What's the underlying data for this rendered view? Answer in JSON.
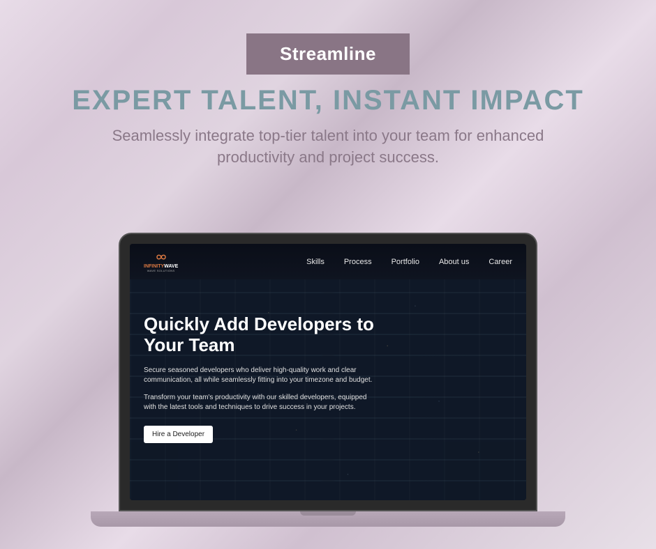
{
  "badge": "Streamline",
  "title": "EXPERT TALENT, INSTANT IMPACT",
  "subtitle": "Seamlessly integrate top-tier talent into your team for enhanced productivity and project success.",
  "site": {
    "logo": {
      "name1": "INFINITY",
      "name2": "WAVE",
      "sub": "WAVE SOLUTIONS"
    },
    "nav": [
      "Skills",
      "Process",
      "Portfolio",
      "About us",
      "Career"
    ],
    "hero": {
      "title": "Quickly Add Developers to Your Team",
      "p1": "Secure seasoned developers who deliver high-quality work and clear communication, all while seamlessly fitting into your timezone and budget.",
      "p2": "Transform your team's productivity with our skilled developers, equipped with the latest tools and techniques to drive success in your projects.",
      "cta": "Hire a Developer"
    }
  }
}
